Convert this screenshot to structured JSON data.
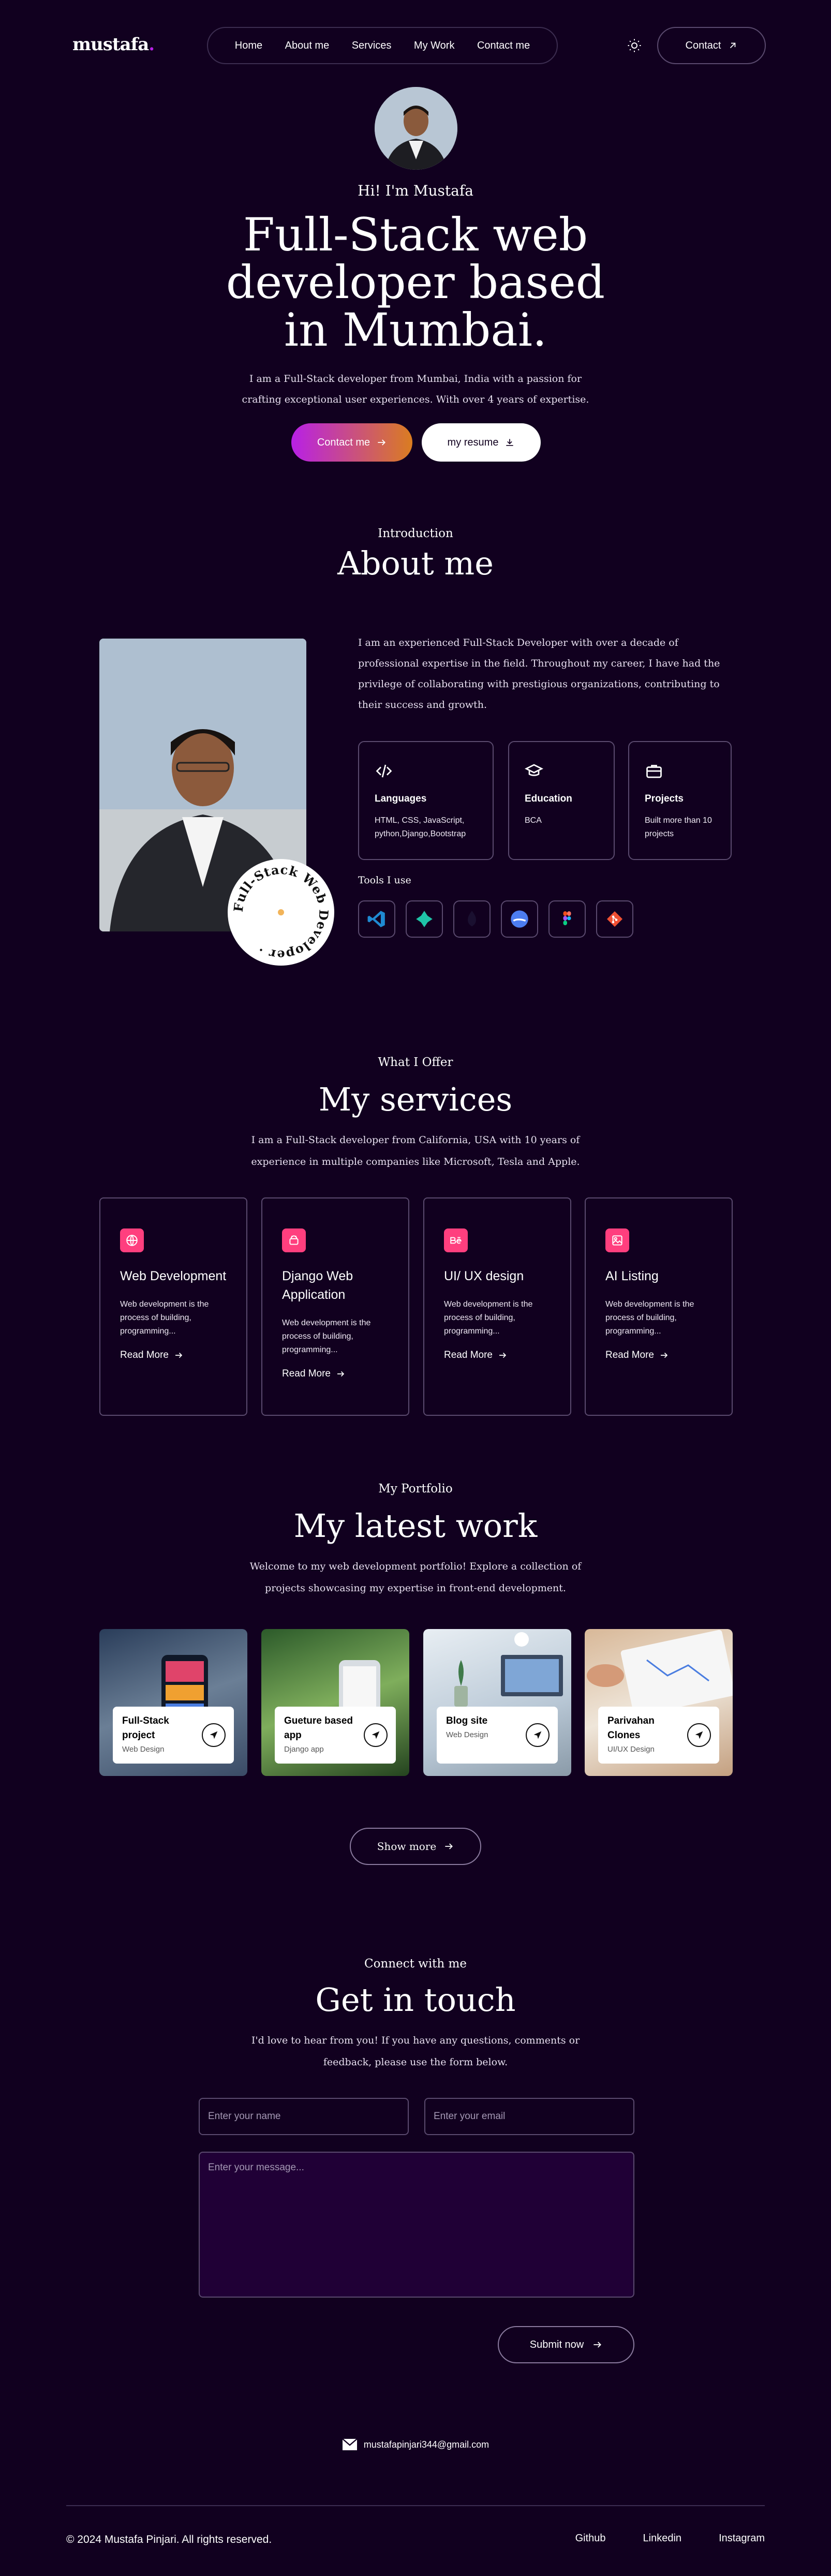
{
  "nav": {
    "logo": "mustafa",
    "links": [
      "Home",
      "About me",
      "Services",
      "My Work",
      "Contact me"
    ],
    "contact_label": "Contact"
  },
  "hero": {
    "greeting": "Hi! I'm Mustafa",
    "title": "Full-Stack web developer based in Mumbai.",
    "description": "I am a Full-Stack developer from Mumbai, India with a passion for crafting exceptional user experiences. With over 4 years of expertise.",
    "primary_button": "Contact me",
    "secondary_button": "my resume"
  },
  "about": {
    "subtitle": "Introduction",
    "title": "About me",
    "text": "I am an experienced Full-Stack Developer with over a decade of professional expertise in the field. Throughout my career, I have had the privilege of collaborating with prestigious organizations, contributing to their success and growth.",
    "badge_text": "Full-Stack Web Developer ·",
    "cards": [
      {
        "icon": "code-icon",
        "title": "Languages",
        "desc": "HTML, CSS, JavaScript, python,Django,Bootstrap"
      },
      {
        "icon": "graduation-cap-icon",
        "title": "Education",
        "desc": "BCA"
      },
      {
        "icon": "briefcase-icon",
        "title": "Projects",
        "desc": "Built more than 10 projects"
      }
    ],
    "tools_label": "Tools I use",
    "tools": [
      "vscode-icon",
      "vector-icon",
      "mongodb-icon",
      "firebase-icon",
      "figma-icon",
      "git-icon"
    ]
  },
  "services": {
    "subtitle": "What I Offer",
    "title": "My services",
    "description": "I am a Full-Stack developer from California, USA with 10 years of experience in multiple companies like Microsoft, Tesla and Apple.",
    "items": [
      {
        "title": "Web Development",
        "desc": "Web development is the process of building, programming...",
        "more": "Read More"
      },
      {
        "title": "Django Web Application",
        "desc": "Web development is the process of building, programming...",
        "more": "Read More"
      },
      {
        "title": "UI/ UX design",
        "desc": "Web development is the process of building, programming...",
        "more": "Read More"
      },
      {
        "title": "AI Listing",
        "desc": "Web development is the process of building, programming...",
        "more": "Read More"
      }
    ]
  },
  "work": {
    "subtitle": "My Portfolio",
    "title": "My latest work",
    "description": "Welcome to my web development portfolio! Explore a collection of projects showcasing my expertise in front-end development.",
    "items": [
      {
        "title": "Full-Stack project",
        "category": "Web Design"
      },
      {
        "title": "Gueture based app",
        "category": "Django app"
      },
      {
        "title": "Blog site",
        "category": "Web Design"
      },
      {
        "title": "Parivahan Clones",
        "category": "UI/UX Design"
      }
    ],
    "show_more": "Show more"
  },
  "contact": {
    "subtitle": "Connect with me",
    "title": "Get in touch",
    "description": "I'd love to hear from you! If you have any questions, comments or feedback, please use the form below.",
    "name_placeholder": "Enter your name",
    "email_placeholder": "Enter your email",
    "message_placeholder": "Enter your message...",
    "submit": "Submit now"
  },
  "footer": {
    "email": "mustafapinjari344@gmail.com",
    "copyright": "© 2024 Mustafa Pinjari. All rights reserved.",
    "links": [
      "Github",
      "Linkedin",
      "Instagram"
    ]
  },
  "colors": {
    "background": "#11001f",
    "accent_purple": "#b820e6",
    "accent_orange": "#da7d20",
    "pink": "#ff3f7e",
    "border": "#5a4a6e"
  }
}
